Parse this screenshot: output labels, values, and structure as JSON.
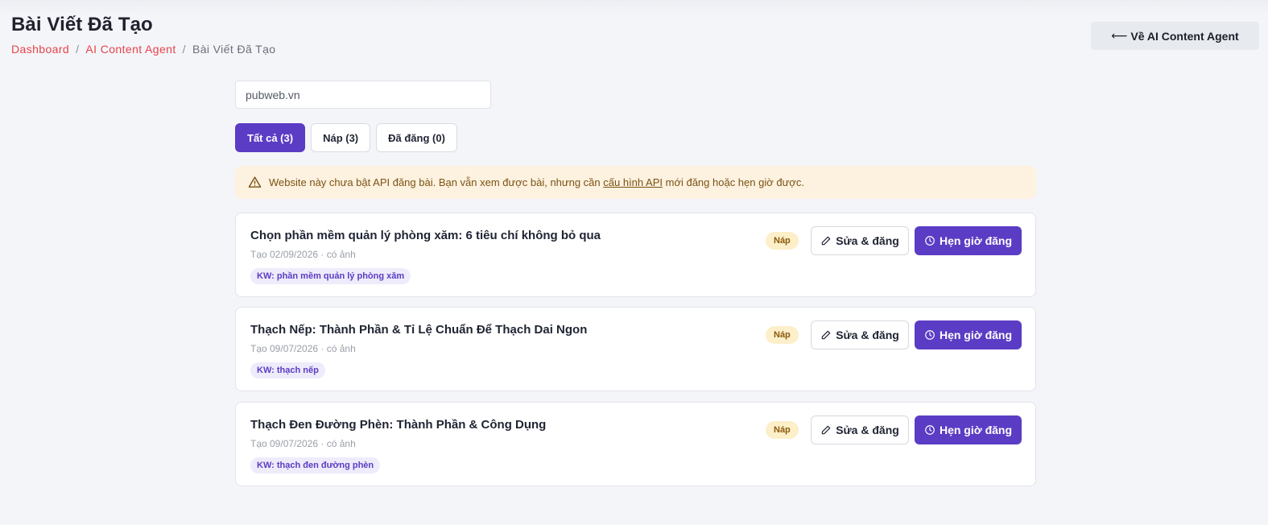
{
  "header": {
    "title": "Bài Viết Đã Tạo",
    "breadcrumb": [
      {
        "label": "Dashboard"
      },
      {
        "label": "AI Content Agent"
      },
      {
        "label": "Bài Viết Đã Tạo"
      }
    ],
    "separator": "/",
    "back_button": {
      "arrow": "⟵",
      "label": "Về AI Content Agent"
    }
  },
  "site_filter": {
    "value": "pubweb.vn"
  },
  "tabs": [
    {
      "label": "Tất cả (3)",
      "active": true
    },
    {
      "label": "Náp (3)",
      "active": false
    },
    {
      "label": "Đã đăng (0)",
      "active": false
    }
  ],
  "warning": {
    "icon": "warning-triangle-icon",
    "text_before": "Website này chưa bật API đăng bài. Bạn vẫn xem được bài, nhưng cần ",
    "link": "cấu hình API",
    "text_after": " mới đăng hoặc hẹn giờ được."
  },
  "posts": [
    {
      "title": "Chọn phần mềm quản lý phòng xăm: 6 tiêu chí không bỏ qua",
      "meta": "Tạo 02/09/2026 · có ảnh",
      "keyword": "KW: phần mềm quản lý phòng xăm",
      "status": "Náp",
      "edit_label": "Sửa & đăng",
      "schedule_label": "Hẹn giờ đăng"
    },
    {
      "title": "Thạch Nếp: Thành Phần & Tỉ Lệ Chuẩn Để Thạch Dai Ngon",
      "meta": "Tạo 09/07/2026 · có ảnh",
      "keyword": "KW: thạch nếp",
      "status": "Náp",
      "edit_label": "Sửa & đăng",
      "schedule_label": "Hẹn giờ đăng"
    },
    {
      "title": "Thạch Đen Đường Phèn: Thành Phần & Công Dụng",
      "meta": "Tạo 09/07/2026 · có ảnh",
      "keyword": "KW: thạch đen đường phèn",
      "status": "Náp",
      "edit_label": "Sửa & đăng",
      "schedule_label": "Hẹn giờ đăng"
    }
  ],
  "colors": {
    "accent": "#5b3cc4",
    "link_red": "#e8434a",
    "warning_bg": "#fdf1e0",
    "draft_badge_bg": "#fcefc9",
    "background": "#f4f5f9"
  }
}
